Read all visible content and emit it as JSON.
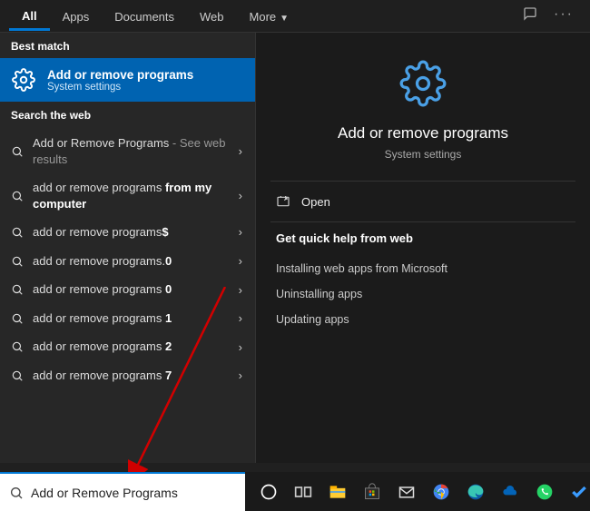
{
  "tabs": {
    "all": "All",
    "apps": "Apps",
    "documents": "Documents",
    "web": "Web",
    "more": "More"
  },
  "sections": {
    "best_match": "Best match",
    "search_web": "Search the web"
  },
  "best_match": {
    "title": "Add or remove programs",
    "subtitle": "System settings"
  },
  "web_items": [
    {
      "prefix": "Add or Remove Programs",
      "suffix": " - See web results",
      "dim_suffix": true
    },
    {
      "prefix": "add or remove programs ",
      "bold": "from my computer"
    },
    {
      "prefix": "add or remove programs",
      "bold": "$"
    },
    {
      "prefix": "add or remove programs.",
      "bold": "0"
    },
    {
      "prefix": "add or remove programs ",
      "bold": "0"
    },
    {
      "prefix": "add or remove programs ",
      "bold": "1"
    },
    {
      "prefix": "add or remove programs ",
      "bold": "2"
    },
    {
      "prefix": "add or remove programs ",
      "bold": "7"
    }
  ],
  "detail": {
    "title": "Add or remove programs",
    "subtitle": "System settings",
    "open": "Open",
    "help_title": "Get quick help from web",
    "help_links": [
      "Installing web apps from Microsoft",
      "Uninstalling apps",
      "Updating apps"
    ]
  },
  "search": {
    "value": "Add or Remove Programs"
  }
}
